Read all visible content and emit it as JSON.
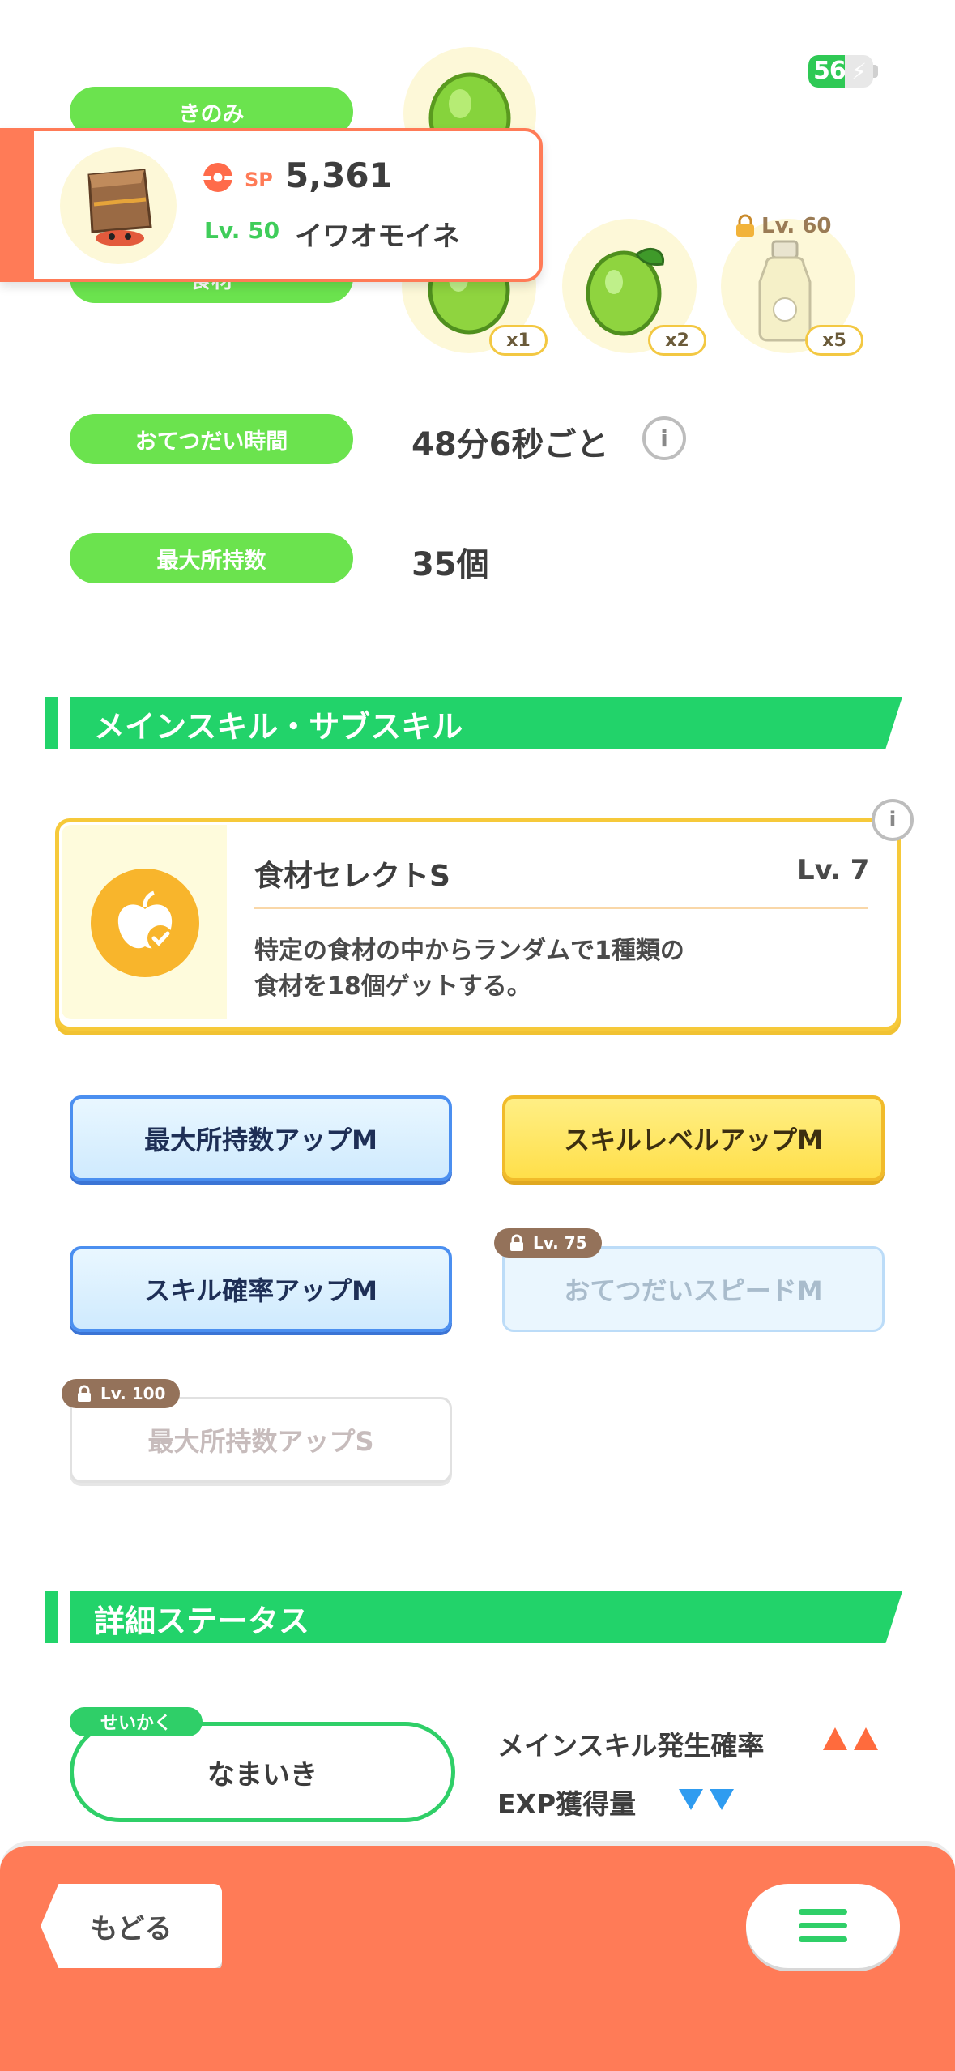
{
  "status": {
    "battery_level": "56",
    "battery_fraction": 0.56,
    "charging": true
  },
  "labels": {
    "berry": "きのみ",
    "ingredient": "食材",
    "help_time": "おてつだい時間",
    "max_carry": "最大所持数"
  },
  "values": {
    "help_time": "48分6秒ごと",
    "max_carry": "35個"
  },
  "ingredients": [
    {
      "count": "x1",
      "icon": "lime-icon"
    },
    {
      "count": "x2",
      "icon": "lime-icon"
    },
    {
      "count": "x5",
      "icon": "oil-bottle-icon",
      "lock_level": "Lv. 60"
    }
  ],
  "pokemon": {
    "sp_label": "SP",
    "sp_value": "5,361",
    "level": "Lv. 50",
    "name": "イワオモイネ"
  },
  "sections": {
    "skills_title": "メインスキル・サブスキル",
    "details_title": "詳細ステータス"
  },
  "main_skill": {
    "name": "食材セレクトS",
    "level": "Lv. 7",
    "desc_line1": "特定の食材の中からランダムで1種類の",
    "desc_line2": "食材を18個ゲットする。"
  },
  "sub_skills": [
    {
      "label": "最大所持数アップM",
      "style": "blue"
    },
    {
      "label": "スキルレベルアップM",
      "style": "gold"
    },
    {
      "label": "スキル確率アップM",
      "style": "blue"
    },
    {
      "label": "おてつだいスピードM",
      "style": "locked",
      "lock_level": "Lv. 75"
    },
    {
      "label": "最大所持数アップS",
      "style": "locked",
      "lock_level": "Lv. 100"
    }
  ],
  "nature": {
    "tag": "せいかく",
    "value": "なまいき",
    "up_stat": "メインスキル発生確率",
    "down_stat": "EXP獲得量",
    "up_color": "#ff6b3d",
    "down_color": "#2f9cf0"
  },
  "nav": {
    "back": "もどる"
  },
  "colors": {
    "accent_green": "#22d36a",
    "pill_green": "#6be34e",
    "bottom_orange": "#ff7b57",
    "skill_gold": "#f6c93a"
  }
}
